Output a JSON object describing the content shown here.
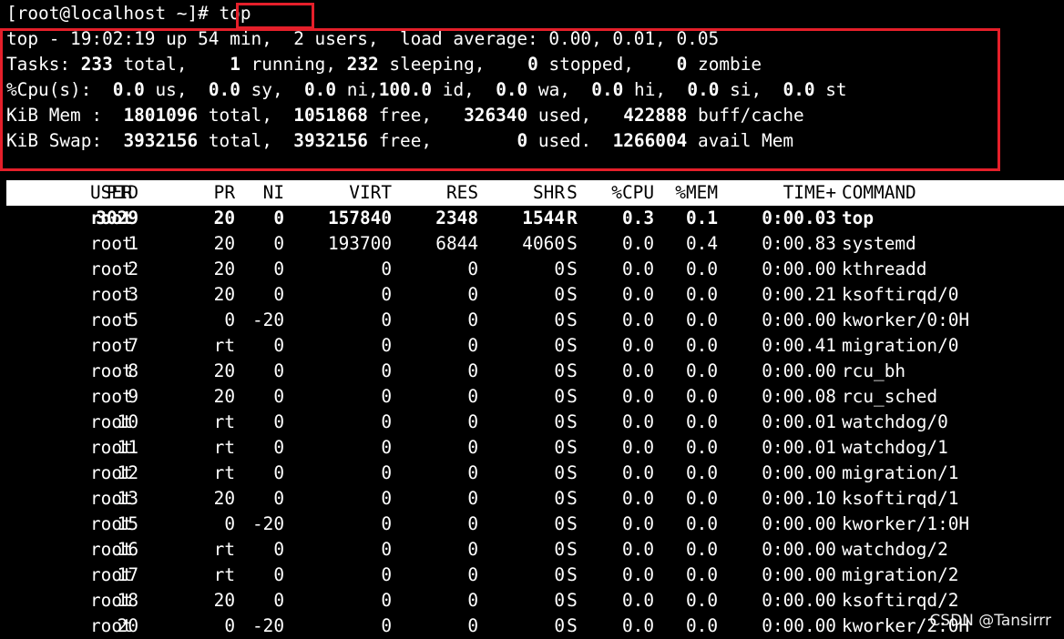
{
  "prompt": {
    "text": "[root@localhost ~]# ",
    "command": "top"
  },
  "summary": {
    "line1": "top - 19:02:19 up 54 min,  2 users,  load average: 0.00, 0.01, 0.05",
    "tasks": {
      "label": "Tasks:",
      "total": "233",
      "total_label": "total,",
      "running": "1",
      "running_label": "running,",
      "sleeping": "232",
      "sleeping_label": "sleeping,",
      "stopped": "0",
      "stopped_label": "stopped,",
      "zombie": "0",
      "zombie_label": "zombie"
    },
    "cpu": {
      "label": "%Cpu(s):",
      "us": "0.0",
      "us_label": "us,",
      "sy": "0.0",
      "sy_label": "sy,",
      "ni": "0.0",
      "ni_label": "ni,",
      "id": "100.0",
      "id_label": "id,",
      "wa": "0.0",
      "wa_label": "wa,",
      "hi": "0.0",
      "hi_label": "hi,",
      "si": "0.0",
      "si_label": "si,",
      "st": "0.0",
      "st_label": "st"
    },
    "mem": {
      "label": "KiB Mem :",
      "total": "1801096",
      "total_label": "total,",
      "free": "1051868",
      "free_label": "free,",
      "used": "326340",
      "used_label": "used,",
      "buff": "422888",
      "buff_label": "buff/cache"
    },
    "swap": {
      "label": "KiB Swap:",
      "total": "3932156",
      "total_label": "total,",
      "free": "3932156",
      "free_label": "free,",
      "used": "0",
      "used_label": "used.",
      "avail": "1266004",
      "avail_label": "avail Mem"
    }
  },
  "table": {
    "headers": {
      "pid": "PID",
      "user": "USER",
      "pr": "PR",
      "ni": "NI",
      "virt": "VIRT",
      "res": "RES",
      "shr": "SHR",
      "s": "S",
      "cpu": "%CPU",
      "mem": "%MEM",
      "time": "TIME+",
      "command": "COMMAND"
    },
    "rows": [
      {
        "pid": "3029",
        "user": "root",
        "pr": "20",
        "ni": "0",
        "virt": "157840",
        "res": "2348",
        "shr": "1544",
        "s": "R",
        "cpu": "0.3",
        "mem": "0.1",
        "time": "0:00.03",
        "command": "top",
        "bold": true
      },
      {
        "pid": "1",
        "user": "root",
        "pr": "20",
        "ni": "0",
        "virt": "193700",
        "res": "6844",
        "shr": "4060",
        "s": "S",
        "cpu": "0.0",
        "mem": "0.4",
        "time": "0:00.83",
        "command": "systemd"
      },
      {
        "pid": "2",
        "user": "root",
        "pr": "20",
        "ni": "0",
        "virt": "0",
        "res": "0",
        "shr": "0",
        "s": "S",
        "cpu": "0.0",
        "mem": "0.0",
        "time": "0:00.00",
        "command": "kthreadd"
      },
      {
        "pid": "3",
        "user": "root",
        "pr": "20",
        "ni": "0",
        "virt": "0",
        "res": "0",
        "shr": "0",
        "s": "S",
        "cpu": "0.0",
        "mem": "0.0",
        "time": "0:00.21",
        "command": "ksoftirqd/0"
      },
      {
        "pid": "5",
        "user": "root",
        "pr": "0",
        "ni": "-20",
        "virt": "0",
        "res": "0",
        "shr": "0",
        "s": "S",
        "cpu": "0.0",
        "mem": "0.0",
        "time": "0:00.00",
        "command": "kworker/0:0H"
      },
      {
        "pid": "7",
        "user": "root",
        "pr": "rt",
        "ni": "0",
        "virt": "0",
        "res": "0",
        "shr": "0",
        "s": "S",
        "cpu": "0.0",
        "mem": "0.0",
        "time": "0:00.41",
        "command": "migration/0"
      },
      {
        "pid": "8",
        "user": "root",
        "pr": "20",
        "ni": "0",
        "virt": "0",
        "res": "0",
        "shr": "0",
        "s": "S",
        "cpu": "0.0",
        "mem": "0.0",
        "time": "0:00.00",
        "command": "rcu_bh"
      },
      {
        "pid": "9",
        "user": "root",
        "pr": "20",
        "ni": "0",
        "virt": "0",
        "res": "0",
        "shr": "0",
        "s": "S",
        "cpu": "0.0",
        "mem": "0.0",
        "time": "0:00.08",
        "command": "rcu_sched"
      },
      {
        "pid": "10",
        "user": "root",
        "pr": "rt",
        "ni": "0",
        "virt": "0",
        "res": "0",
        "shr": "0",
        "s": "S",
        "cpu": "0.0",
        "mem": "0.0",
        "time": "0:00.01",
        "command": "watchdog/0"
      },
      {
        "pid": "11",
        "user": "root",
        "pr": "rt",
        "ni": "0",
        "virt": "0",
        "res": "0",
        "shr": "0",
        "s": "S",
        "cpu": "0.0",
        "mem": "0.0",
        "time": "0:00.01",
        "command": "watchdog/1"
      },
      {
        "pid": "12",
        "user": "root",
        "pr": "rt",
        "ni": "0",
        "virt": "0",
        "res": "0",
        "shr": "0",
        "s": "S",
        "cpu": "0.0",
        "mem": "0.0",
        "time": "0:00.00",
        "command": "migration/1"
      },
      {
        "pid": "13",
        "user": "root",
        "pr": "20",
        "ni": "0",
        "virt": "0",
        "res": "0",
        "shr": "0",
        "s": "S",
        "cpu": "0.0",
        "mem": "0.0",
        "time": "0:00.10",
        "command": "ksoftirqd/1"
      },
      {
        "pid": "15",
        "user": "root",
        "pr": "0",
        "ni": "-20",
        "virt": "0",
        "res": "0",
        "shr": "0",
        "s": "S",
        "cpu": "0.0",
        "mem": "0.0",
        "time": "0:00.00",
        "command": "kworker/1:0H"
      },
      {
        "pid": "16",
        "user": "root",
        "pr": "rt",
        "ni": "0",
        "virt": "0",
        "res": "0",
        "shr": "0",
        "s": "S",
        "cpu": "0.0",
        "mem": "0.0",
        "time": "0:00.00",
        "command": "watchdog/2"
      },
      {
        "pid": "17",
        "user": "root",
        "pr": "rt",
        "ni": "0",
        "virt": "0",
        "res": "0",
        "shr": "0",
        "s": "S",
        "cpu": "0.0",
        "mem": "0.0",
        "time": "0:00.00",
        "command": "migration/2"
      },
      {
        "pid": "18",
        "user": "root",
        "pr": "20",
        "ni": "0",
        "virt": "0",
        "res": "0",
        "shr": "0",
        "s": "S",
        "cpu": "0.0",
        "mem": "0.0",
        "time": "0:00.00",
        "command": "ksoftirqd/2"
      },
      {
        "pid": "20",
        "user": "root",
        "pr": "0",
        "ni": "-20",
        "virt": "0",
        "res": "0",
        "shr": "0",
        "s": "S",
        "cpu": "0.0",
        "mem": "0.0",
        "time": "0:00.00",
        "command": "kworker/2:0H"
      }
    ]
  },
  "watermark": "CSDN @Tansirrr",
  "colors": {
    "background": "#000000",
    "foreground": "#ffffff",
    "highlight_box": "#e51f2a",
    "header_bg": "#ffffff",
    "header_fg": "#000000"
  }
}
